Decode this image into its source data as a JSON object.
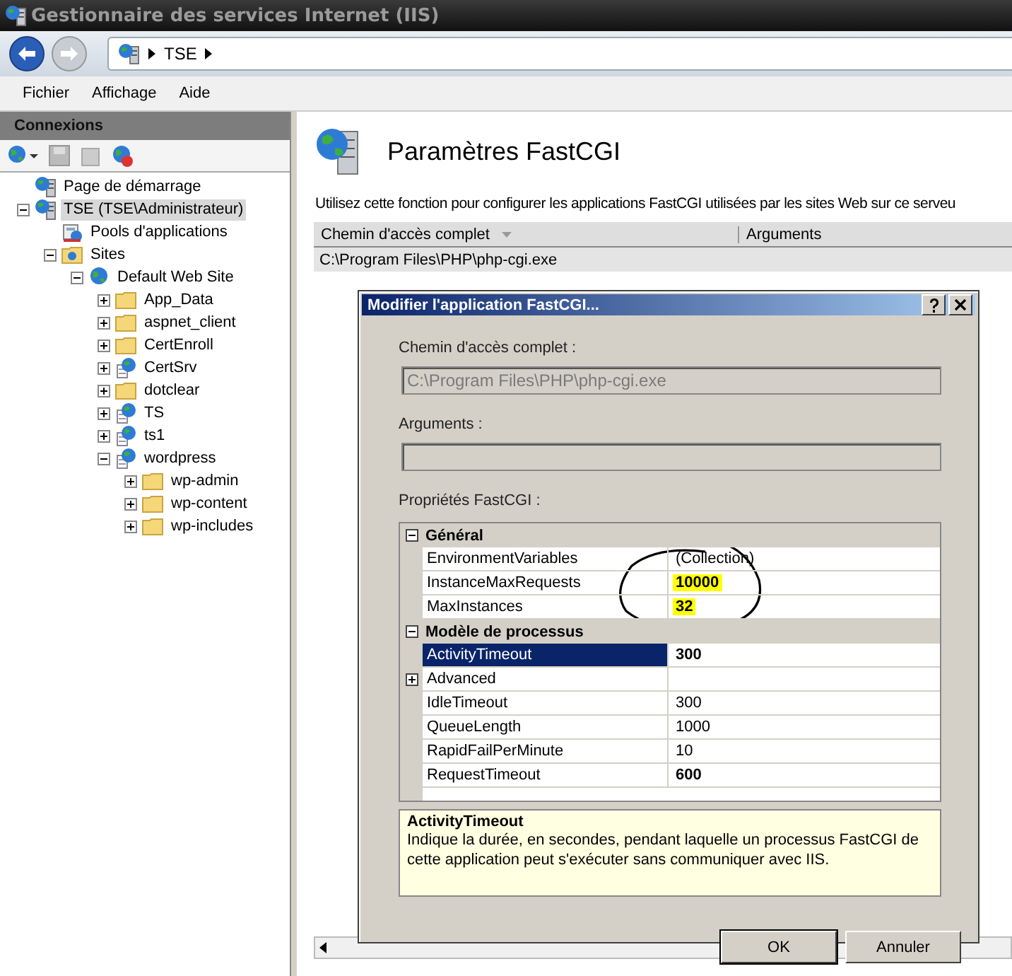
{
  "window": {
    "title": "Gestionnaire des services Internet (IIS)"
  },
  "address": {
    "segments": [
      "TSE"
    ]
  },
  "menu": [
    "Fichier",
    "Affichage",
    "Aide"
  ],
  "connections": {
    "title": "Connexions",
    "tree": [
      {
        "label": "Page de démarrage",
        "kind": "server",
        "selected": false
      },
      {
        "label": "TSE (TSE\\Administrateur)",
        "kind": "server",
        "selected": true,
        "expanded": true,
        "children": [
          {
            "label": "Pools d'applications",
            "kind": "pool",
            "selected": false
          },
          {
            "label": "Sites",
            "kind": "sites",
            "selected": false,
            "expanded": true,
            "children": [
              {
                "label": "Default Web Site",
                "kind": "globe",
                "selected": false,
                "expanded": true,
                "children": [
                  {
                    "label": "App_Data",
                    "kind": "folder",
                    "selected": false,
                    "expanded": false
                  },
                  {
                    "label": "aspnet_client",
                    "kind": "folder",
                    "selected": false,
                    "expanded": false
                  },
                  {
                    "label": "CertEnroll",
                    "kind": "folder",
                    "selected": false,
                    "expanded": false
                  },
                  {
                    "label": "CertSrv",
                    "kind": "app",
                    "selected": false,
                    "expanded": false
                  },
                  {
                    "label": "dotclear",
                    "kind": "folder",
                    "selected": false,
                    "expanded": false
                  },
                  {
                    "label": "TS",
                    "kind": "app",
                    "selected": false,
                    "expanded": false
                  },
                  {
                    "label": "ts1",
                    "kind": "app",
                    "selected": false,
                    "expanded": false
                  },
                  {
                    "label": "wordpress",
                    "kind": "app",
                    "selected": false,
                    "expanded": true,
                    "children": [
                      {
                        "label": "wp-admin",
                        "kind": "folder",
                        "selected": false,
                        "expanded": false
                      },
                      {
                        "label": "wp-content",
                        "kind": "folder",
                        "selected": false,
                        "expanded": false
                      },
                      {
                        "label": "wp-includes",
                        "kind": "folder",
                        "selected": false,
                        "expanded": false
                      }
                    ]
                  }
                ]
              }
            ]
          }
        ]
      }
    ]
  },
  "page": {
    "title": "Paramètres FastCGI",
    "description": "Utilisez cette fonction pour configurer les applications FastCGI utilisées par les sites Web sur ce serveu",
    "table": {
      "columns": [
        "Chemin d'accès complet",
        "Arguments"
      ],
      "rows": [
        {
          "cells": [
            "C:\\Program Files\\PHP\\php-cgi.exe",
            ""
          ],
          "selected": true
        }
      ]
    }
  },
  "dialog": {
    "title": "Modifier l'application FastCGI...",
    "path_label": "Chemin d'accès complet :",
    "path_value": "C:\\Program Files\\PHP\\php-cgi.exe",
    "args_label": "Arguments :",
    "props_label": "Propriétés FastCGI :",
    "categories": [
      {
        "name": "Général",
        "expanded": true,
        "rows": [
          {
            "name": "EnvironmentVariables",
            "value": "(Collection)",
            "modified": false,
            "highlighted": false,
            "selected": false
          },
          {
            "name": "InstanceMaxRequests",
            "value": "10000",
            "modified": true,
            "highlighted": true,
            "selected": false
          },
          {
            "name": "MaxInstances",
            "value": "32",
            "modified": true,
            "highlighted": true,
            "selected": false
          }
        ]
      },
      {
        "name": "Modèle de processus",
        "expanded": true,
        "rows": [
          {
            "name": "ActivityTimeout",
            "value": "300",
            "modified": true,
            "highlighted": false,
            "selected": true
          },
          {
            "name": "Advanced",
            "value": "",
            "modified": false,
            "highlighted": false,
            "selected": false,
            "expanded": false
          },
          {
            "name": "IdleTimeout",
            "value": "300",
            "modified": false,
            "highlighted": false,
            "selected": false
          },
          {
            "name": "QueueLength",
            "value": "1000",
            "modified": false,
            "highlighted": false,
            "selected": false
          },
          {
            "name": "RapidFailPerMinute",
            "value": "10",
            "modified": false,
            "highlighted": false,
            "selected": false
          },
          {
            "name": "RequestTimeout",
            "value": "600",
            "modified": true,
            "highlighted": false,
            "selected": false
          }
        ]
      }
    ],
    "help_title": "ActivityTimeout",
    "help_text": "Indique la durée, en secondes, pendant laquelle un processus FastCGI de cette application peut s'exécuter sans communiquer avec IIS.",
    "buttons": [
      {
        "label": "OK",
        "default": true
      },
      {
        "label": "Annuler",
        "default": false
      }
    ]
  }
}
